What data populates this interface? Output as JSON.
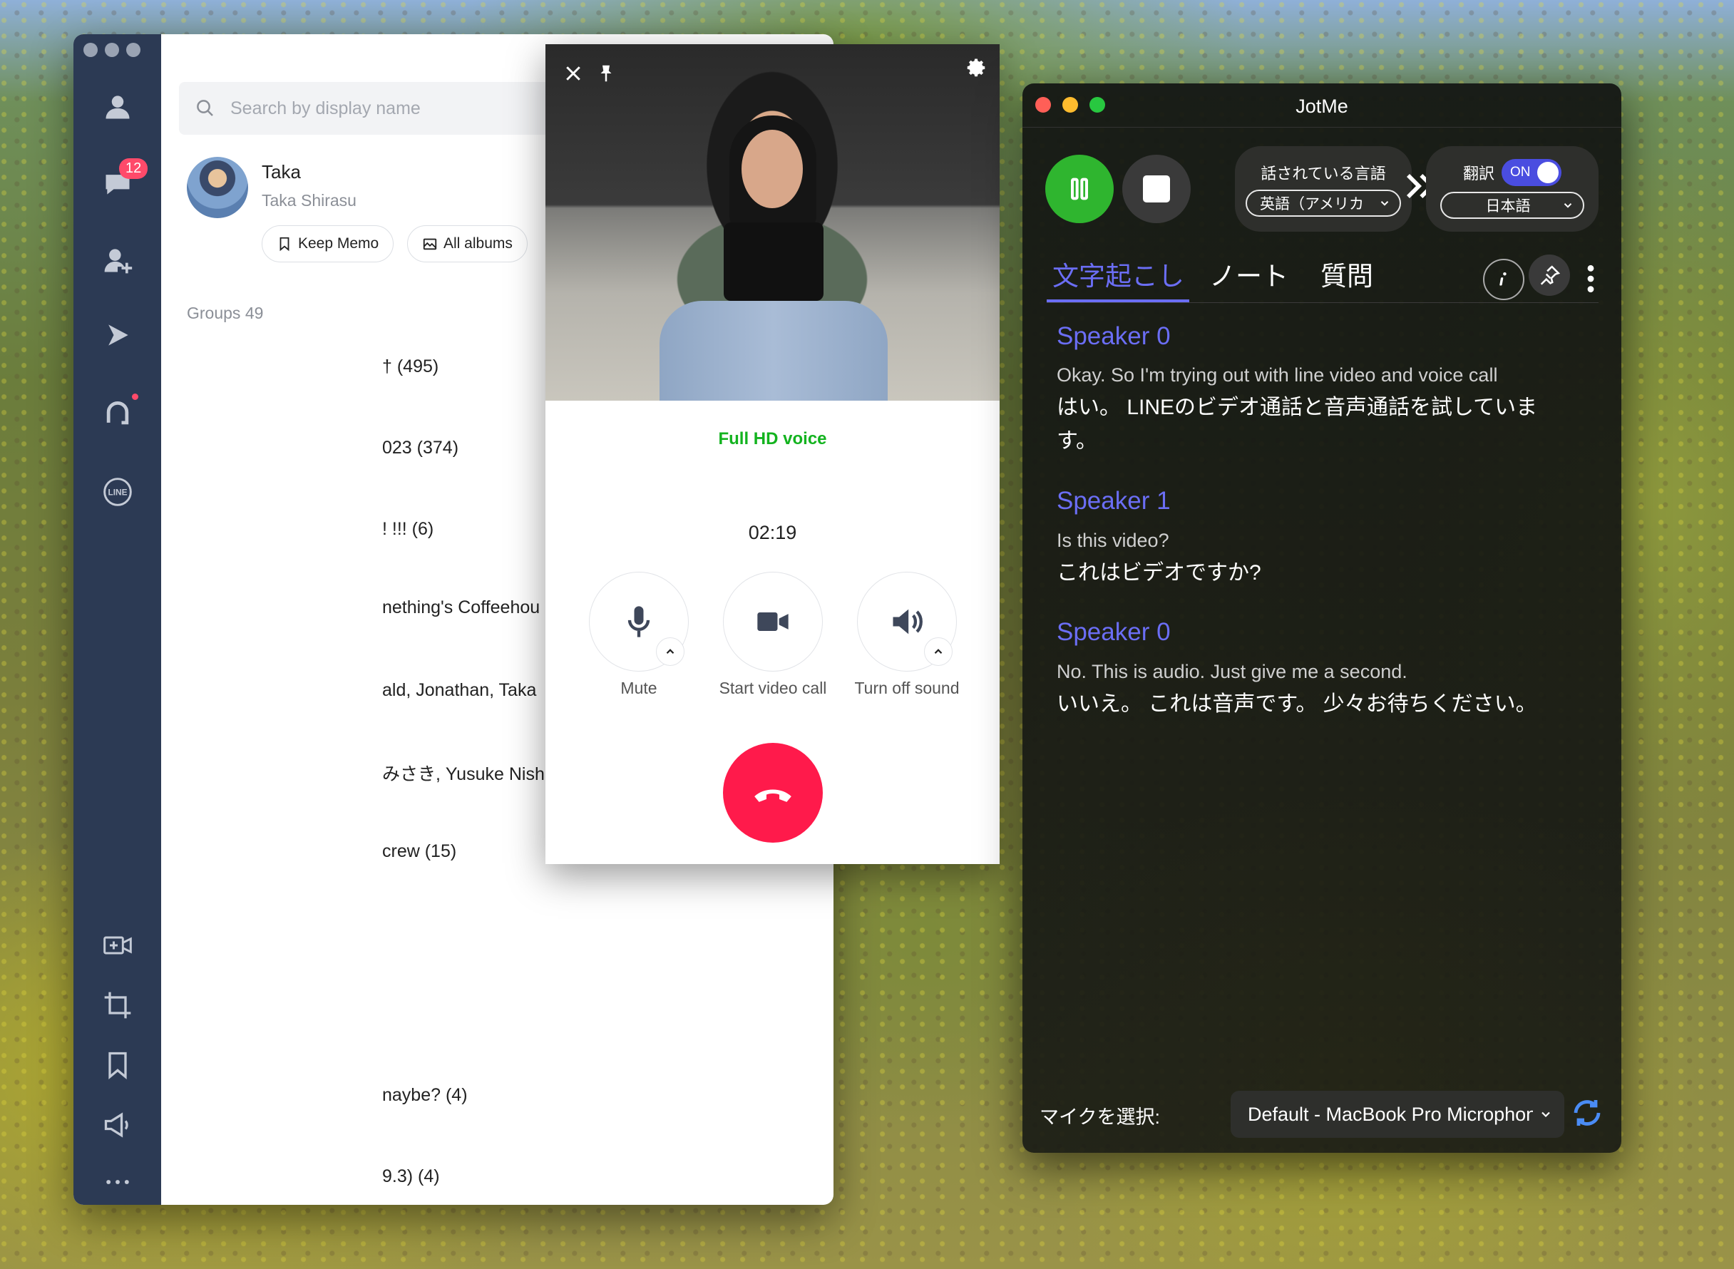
{
  "line": {
    "badge_count": "12",
    "search_placeholder": "Search by display name",
    "profile": {
      "name": "Taka",
      "subtitle": "Taka Shirasu"
    },
    "keep_memo": "Keep Memo",
    "all_albums": "All albums",
    "groups_label": "Groups 49",
    "groups": [
      "† (495)",
      "023  (374)",
      "! !!! (6)",
      "nething's Coffeehou",
      "ald, Jonathan, Taka",
      "みさき, Yusuke Nishi",
      "crew  (15)",
      "naybe?  (4)",
      "9.3)  (4)"
    ]
  },
  "call": {
    "quality": "Full HD voice",
    "timer": "02:19",
    "mute_label": "Mute",
    "video_label": "Start video call",
    "sound_label": "Turn off sound",
    "hangup_color": "#ff1a4b"
  },
  "jotme": {
    "title": "JotMe",
    "spoken_language_label": "話されている言語",
    "spoken_language_value": "英語（アメリカ",
    "translate_label": "翻訳",
    "toggle_label": "ON",
    "target_language_value": "日本語",
    "tabs": [
      "文字起こし",
      "ノート",
      "質問"
    ],
    "transcript": [
      {
        "speaker": "Speaker 0",
        "source": "Okay. So I'm trying out with line video and voice call",
        "translation": "はい。 LINEのビデオ通話と音声通話を試しています。"
      },
      {
        "speaker": "Speaker 1",
        "source": "Is this video?",
        "translation": "これはビデオですか?"
      },
      {
        "speaker": "Speaker 0",
        "source": "No. This is audio. Just give me a second.",
        "translation": "いいえ。 これは音声です。 少々お待ちください。"
      }
    ],
    "mic_label": "マイクを選択:",
    "mic_value": "Default - MacBook Pro Microphone",
    "accent_color": "#6b6ef5"
  }
}
